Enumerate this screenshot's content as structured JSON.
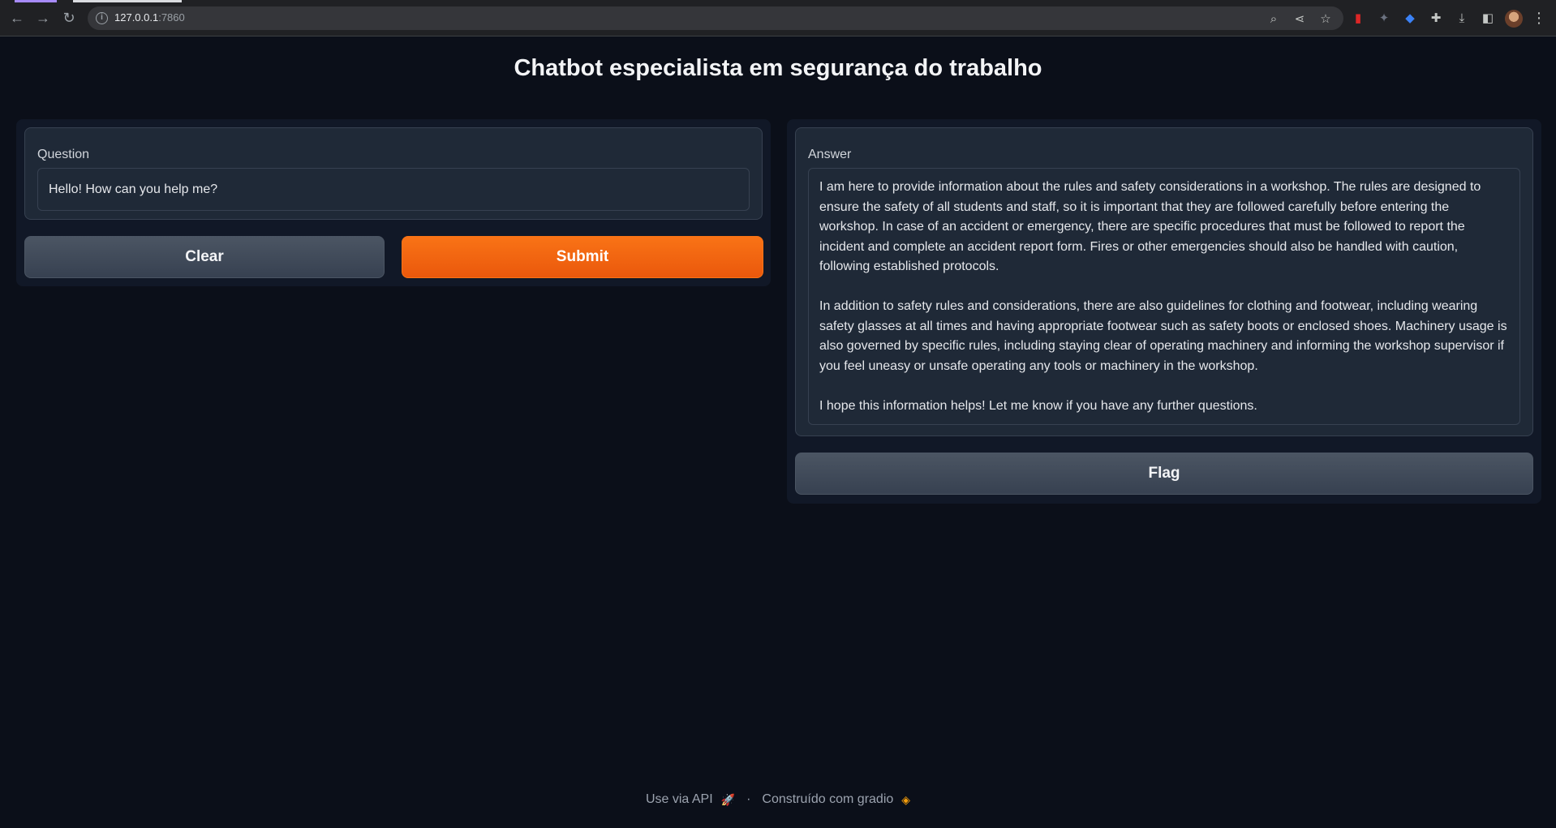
{
  "browser": {
    "url_host": "127.0.0.1",
    "url_port": ":7860"
  },
  "app": {
    "title": "Chatbot especialista em segurança do trabalho"
  },
  "question": {
    "label": "Question",
    "value": "Hello! How can you help me?"
  },
  "buttons": {
    "clear": "Clear",
    "submit": "Submit",
    "flag": "Flag"
  },
  "answer": {
    "label": "Answer",
    "paragraphs": [
      "I am here to provide information about the rules and safety considerations in a workshop. The rules are designed to ensure the safety of all students and staff, so it is important that they are followed carefully before entering the workshop. In case of an accident or emergency, there are specific procedures that must be followed to report the incident and complete an accident report form. Fires or other emergencies should also be handled with caution, following established protocols.",
      "In addition to safety rules and considerations, there are also guidelines for clothing and footwear, including wearing safety glasses at all times and having appropriate footwear such as safety boots or enclosed shoes. Machinery usage is also governed by specific rules, including staying clear of operating machinery and informing the workshop supervisor if you feel uneasy or unsafe operating any tools or machinery in the workshop.",
      "I hope this information helps! Let me know if you have any further questions."
    ]
  },
  "footer": {
    "api_link": "Use via API",
    "separator": "·",
    "built_with": "Construído com gradio"
  },
  "colors": {
    "background": "#0b0f19",
    "accent": "#f97316"
  }
}
